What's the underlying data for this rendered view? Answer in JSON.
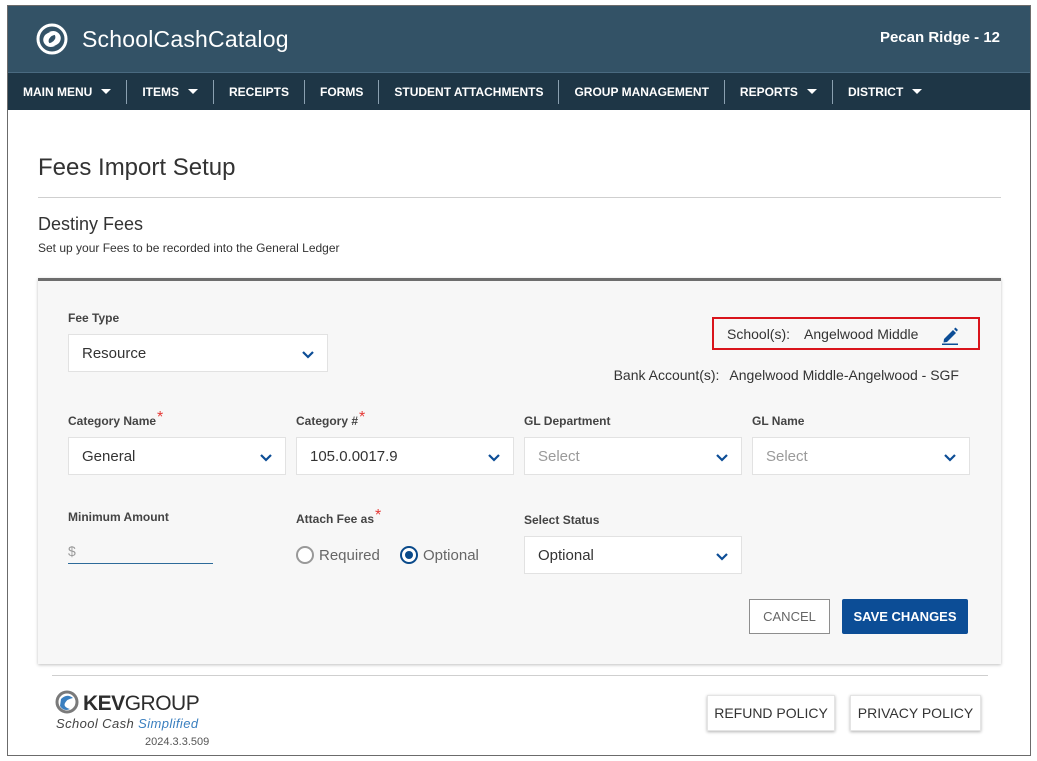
{
  "header": {
    "brand": "SchoolCashCatalog",
    "school": "Pecan Ridge - 12"
  },
  "nav": {
    "items": [
      {
        "label": "MAIN MENU",
        "dropdown": true
      },
      {
        "label": "ITEMS",
        "dropdown": true
      },
      {
        "label": "RECEIPTS",
        "dropdown": false
      },
      {
        "label": "FORMS",
        "dropdown": false
      },
      {
        "label": "STUDENT ATTACHMENTS",
        "dropdown": false
      },
      {
        "label": "GROUP MANAGEMENT",
        "dropdown": false
      },
      {
        "label": "REPORTS",
        "dropdown": true
      },
      {
        "label": "DISTRICT",
        "dropdown": true
      }
    ]
  },
  "page": {
    "title": "Fees Import Setup",
    "section_title": "Destiny Fees",
    "section_subtitle": "Set up your Fees to be recorded into the General Ledger"
  },
  "form": {
    "fee_type": {
      "label": "Fee Type",
      "value": "Resource"
    },
    "schools": {
      "label": "School(s):",
      "value": "Angelwood Middle"
    },
    "bank_account": {
      "label": "Bank Account(s):",
      "value": "Angelwood Middle-Angelwood - SGF"
    },
    "category_name": {
      "label": "Category Name",
      "value": "General",
      "required": "*"
    },
    "category_number": {
      "label": "Category #",
      "value": "105.0.0017.9",
      "required": "*"
    },
    "gl_department": {
      "label": "GL Department",
      "placeholder": "Select"
    },
    "gl_name": {
      "label": "GL Name",
      "placeholder": "Select"
    },
    "minimum_amount": {
      "label": "Minimum Amount",
      "prefix": "$",
      "value": ""
    },
    "attach_fee_as": {
      "label": "Attach Fee as",
      "required": "*",
      "options": [
        "Required",
        "Optional"
      ],
      "selected": "Optional"
    },
    "select_status": {
      "label": "Select Status",
      "value": "Optional"
    },
    "cancel_label": "CANCEL",
    "save_label": "SAVE CHANGES"
  },
  "footer": {
    "logo_text_bold": "KEV",
    "logo_text_thin": "GROUP",
    "tagline_plain": "School Cash",
    "tagline_blue": "Simplified",
    "version": "2024.3.3.509",
    "refund_label": "REFUND POLICY",
    "privacy_label": "PRIVACY POLICY"
  },
  "colors": {
    "header_bg": "#335266",
    "nav_bg": "#1e3646",
    "primary_button": "#0c4d96",
    "highlight_border": "#d9141b",
    "required_star": "#e53935"
  },
  "icons": [
    "school-cash-logo-icon",
    "caret-down-icon",
    "chevron-down-icon",
    "pencil-edit-icon",
    "kevgroup-logo-icon"
  ]
}
